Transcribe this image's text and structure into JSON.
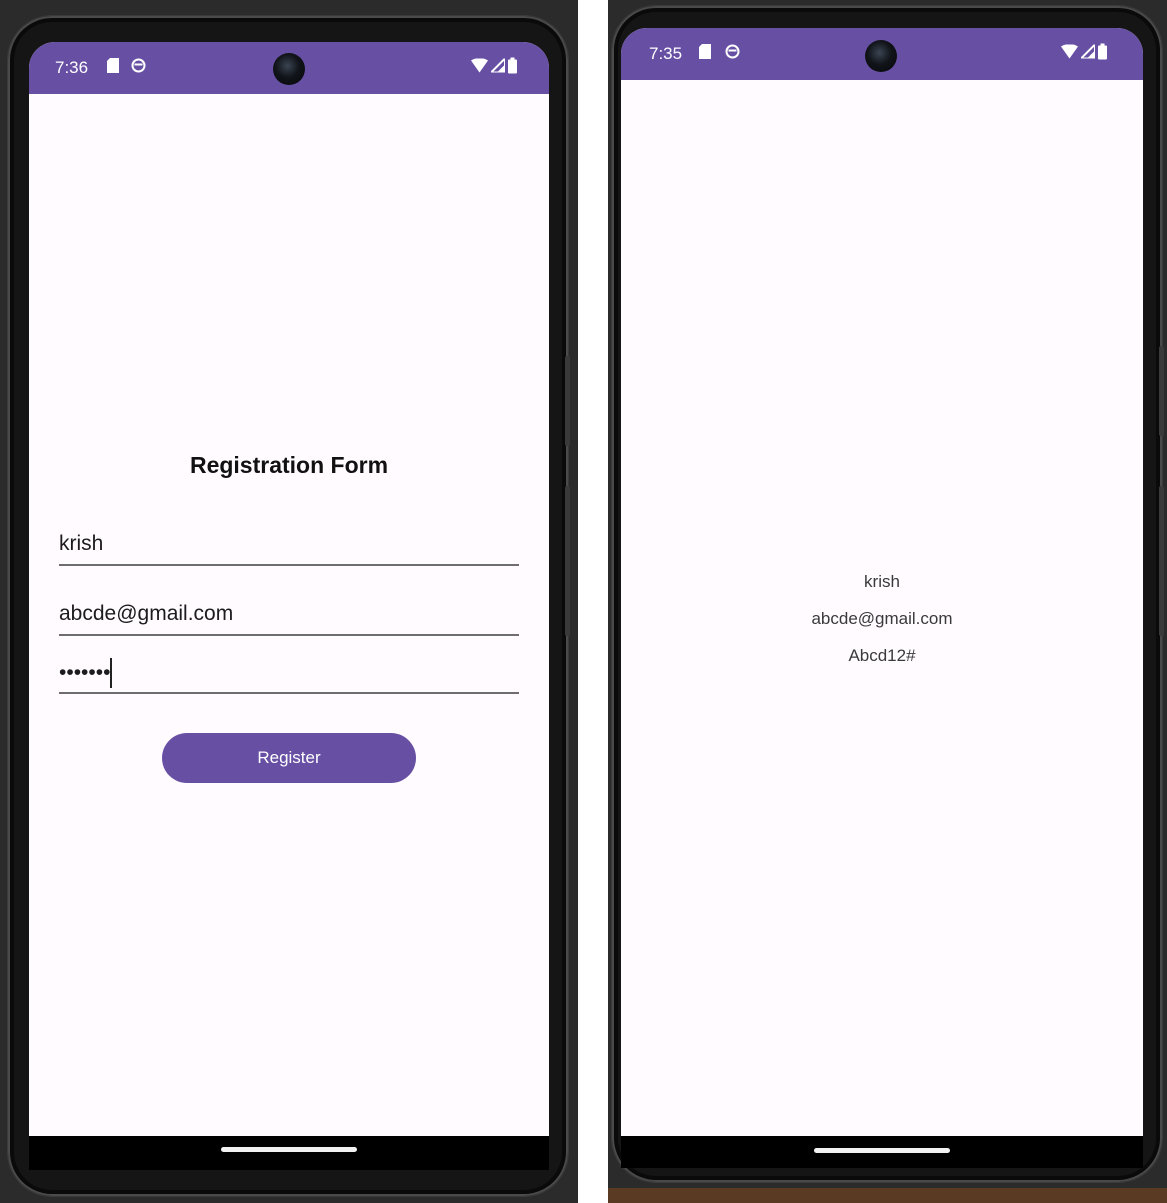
{
  "left_phone": {
    "status_bar": {
      "time": "7:36",
      "icons": [
        "sd-card-icon",
        "media-icon",
        "wifi-icon",
        "signal-icon",
        "battery-icon"
      ]
    },
    "form": {
      "title": "Registration Form",
      "name_value": "krish",
      "email_value": "abcde@gmail.com",
      "password_masked": "•••••••",
      "register_label": "Register"
    }
  },
  "right_phone": {
    "status_bar": {
      "time": "7:35",
      "icons": [
        "sd-card-icon",
        "media-icon",
        "wifi-icon",
        "signal-icon",
        "battery-icon"
      ]
    },
    "result": {
      "name": "krish",
      "email": "abcde@gmail.com",
      "password": "Abcd12#"
    }
  },
  "colors": {
    "accent": "#6750a4",
    "screen_background": "#fffbfe",
    "nav_bar": "#000000"
  }
}
